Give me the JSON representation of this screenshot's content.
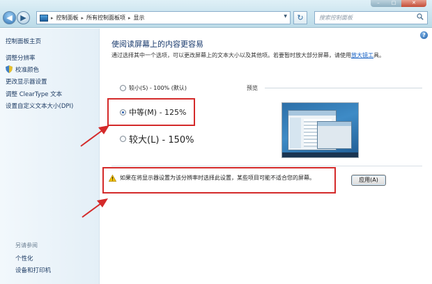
{
  "titlebar": {
    "address": {
      "segments": [
        "控制面板",
        "所有控制面板项",
        "显示"
      ]
    },
    "search": {
      "placeholder": "搜索控制面板"
    }
  },
  "sidebar": {
    "home": "控制面板主页",
    "items": [
      "调整分辨率",
      "校准颜色",
      "更改显示器设置",
      "调整 ClearType 文本",
      "设置自定义文本大小(DPI)"
    ],
    "see_also": "另请参阅",
    "see_also_items": [
      "个性化",
      "设备和打印机"
    ]
  },
  "main": {
    "title": "使阅读屏幕上的内容更容易",
    "description": "通过选择其中一个选项，可以更改屏幕上的文本大小以及其他项。若要暂时放大部分屏幕，请使用",
    "description_link": "放大镜工",
    "description_tail": "具。",
    "options": [
      {
        "label": "较小(S) - 100% (默认)",
        "selected": false
      },
      {
        "label": "中等(M) - 125%",
        "selected": true
      },
      {
        "label": "较大(L) - 150%",
        "selected": false
      }
    ],
    "preview_label": "预览",
    "warning": "如果在将显示器设置为该分辨率时选择此设置，某些项目可能不适合您的屏幕。",
    "apply_button": "应用(A)",
    "help": "?"
  },
  "colors": {
    "annotation": "#d42a2a",
    "link": "#1560c4",
    "title_text": "#1a3b6e"
  }
}
